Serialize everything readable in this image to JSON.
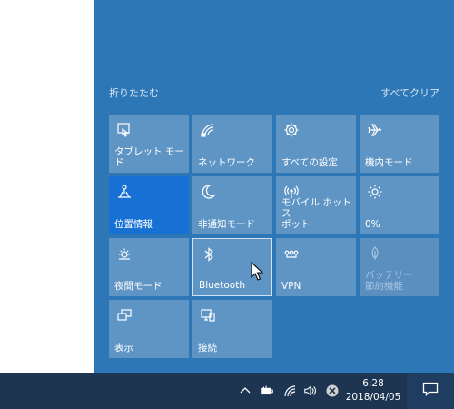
{
  "header": {
    "collapse_label": "折りたたむ",
    "clear_all_label": "すべてクリア"
  },
  "tiles": [
    {
      "label": "タブレット モード",
      "icon": "tablet-mode-icon",
      "state": "off"
    },
    {
      "label": "ネットワーク",
      "icon": "network-icon",
      "state": "off"
    },
    {
      "label": "すべての設定",
      "icon": "settings-gear-icon",
      "state": "off"
    },
    {
      "label": "機内モード",
      "icon": "airplane-icon",
      "state": "off"
    },
    {
      "label": "位置情報",
      "icon": "location-icon",
      "state": "on"
    },
    {
      "label": "非通知モード",
      "icon": "moon-icon",
      "state": "off"
    },
    {
      "label": "モバイル ホットス\nポット",
      "icon": "hotspot-icon",
      "state": "off"
    },
    {
      "label": "0%",
      "icon": "brightness-icon",
      "state": "off"
    },
    {
      "label": "夜間モード",
      "icon": "night-light-icon",
      "state": "off"
    },
    {
      "label": "Bluetooth",
      "icon": "bluetooth-icon",
      "state": "hover"
    },
    {
      "label": "VPN",
      "icon": "vpn-icon",
      "state": "off"
    },
    {
      "label": "バッテリー\n節約機能",
      "icon": "battery-saver-icon",
      "state": "disabled"
    },
    {
      "label": "表示",
      "icon": "project-display-icon",
      "state": "off"
    },
    {
      "label": "接続",
      "icon": "connect-icon",
      "state": "off"
    }
  ],
  "taskbar": {
    "time": "6:28",
    "date": "2018/04/05"
  },
  "colors": {
    "panel_bg": "#2e77b6",
    "tile_bg": "#5f95c5",
    "tile_active": "#1770d3",
    "taskbar_bg": "#1e3552"
  }
}
